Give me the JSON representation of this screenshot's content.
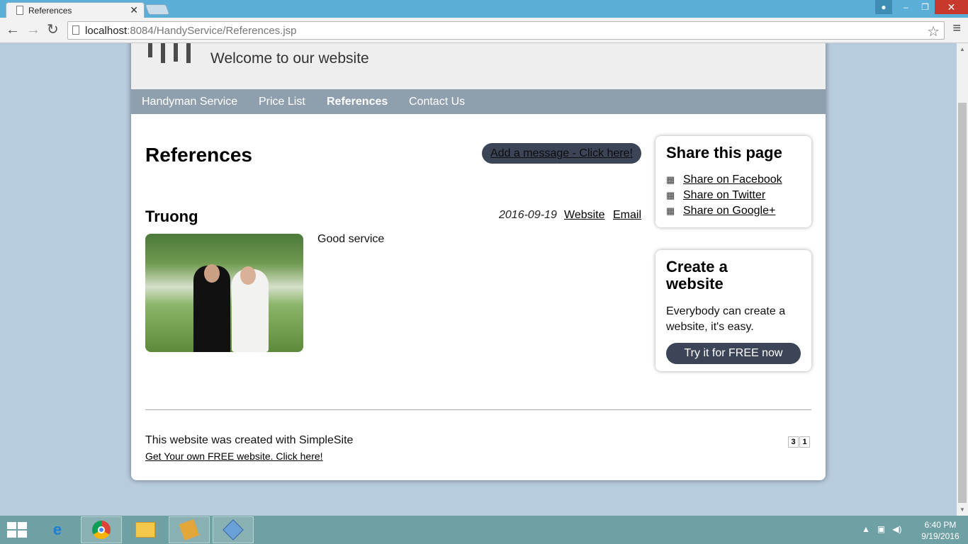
{
  "browser": {
    "tab_title": "References",
    "url_host": "localhost",
    "url_rest": ":8084/HandyService/References.jsp"
  },
  "site": {
    "tagline": "Welcome to our website",
    "nav": [
      "Handyman Service",
      "Price List",
      "References",
      "Contact Us"
    ],
    "active_nav": "References"
  },
  "main": {
    "heading": "References",
    "add_message": "Add a message - Click here!",
    "entry": {
      "name": "Truong",
      "date": "2016-09-19",
      "website_link": "Website",
      "email_link": "Email",
      "text": "Good service"
    }
  },
  "sidebar": {
    "share": {
      "title": "Share this page",
      "links": [
        {
          "label": "Share on Facebook",
          "icon": "facebook-icon"
        },
        {
          "label": "Share on Twitter",
          "icon": "twitter-icon"
        },
        {
          "label": "Share on Google+",
          "icon": "googleplus-icon"
        }
      ]
    },
    "create": {
      "title": "Create a website",
      "text": "Everybody can create a website, it's easy.",
      "button": "Try it for FREE now"
    }
  },
  "footer": {
    "line1": "This website was created with SimpleSite",
    "line2": "Get Your own FREE website. Click here!",
    "counter": [
      "3",
      "1"
    ]
  },
  "taskbar": {
    "time": "6:40 PM",
    "date": "9/19/2016"
  },
  "colors": {
    "button_dark": "#3c4457",
    "nav_bar": "#8f9fae",
    "page_background": "#b8ccdf"
  }
}
